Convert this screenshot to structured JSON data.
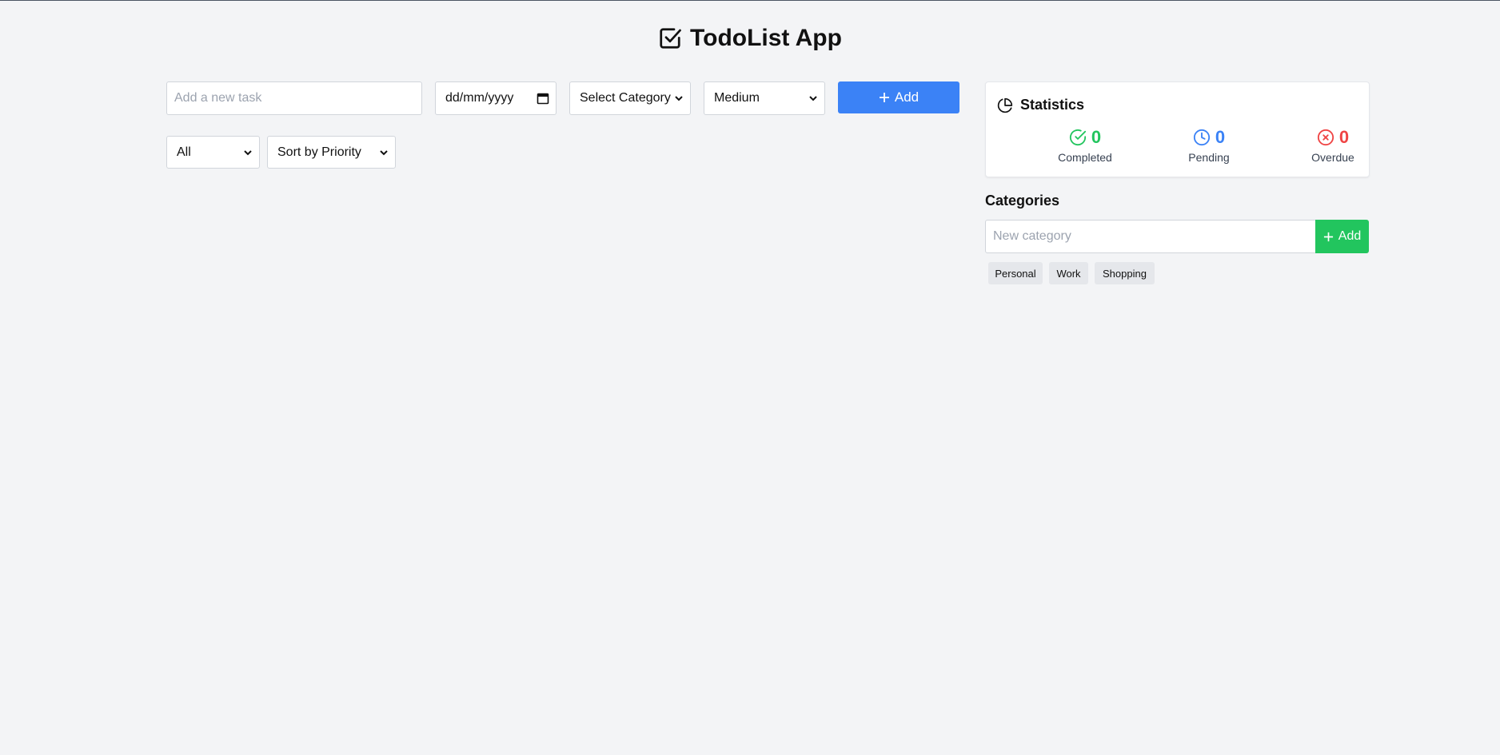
{
  "header": {
    "title": "TodoList App",
    "icon": "checkbox-icon"
  },
  "task_form": {
    "task_input_placeholder": "Add a new task",
    "date_placeholder": "dd/mm/yyyy",
    "category_select": "Select Category",
    "priority_select": "Medium",
    "add_button_label": "Add"
  },
  "filters": {
    "status_filter": "All",
    "sort_select": "Sort by Priority"
  },
  "statistics": {
    "title": "Statistics",
    "completed": {
      "value": "0",
      "label": "Completed",
      "color": "#22c55e",
      "icon": "check-circle-icon"
    },
    "pending": {
      "value": "0",
      "label": "Pending",
      "color": "#3b82f6",
      "icon": "clock-icon"
    },
    "overdue": {
      "value": "0",
      "label": "Overdue",
      "color": "#ef4444",
      "icon": "x-circle-icon"
    }
  },
  "categories": {
    "title": "Categories",
    "input_placeholder": "New category",
    "add_button_label": "Add",
    "items": [
      "Personal",
      "Work",
      "Shopping"
    ]
  },
  "colors": {
    "background": "#f3f4f6",
    "primary_blue": "#3b82f6",
    "success_green": "#22c55e",
    "danger_red": "#ef4444"
  }
}
